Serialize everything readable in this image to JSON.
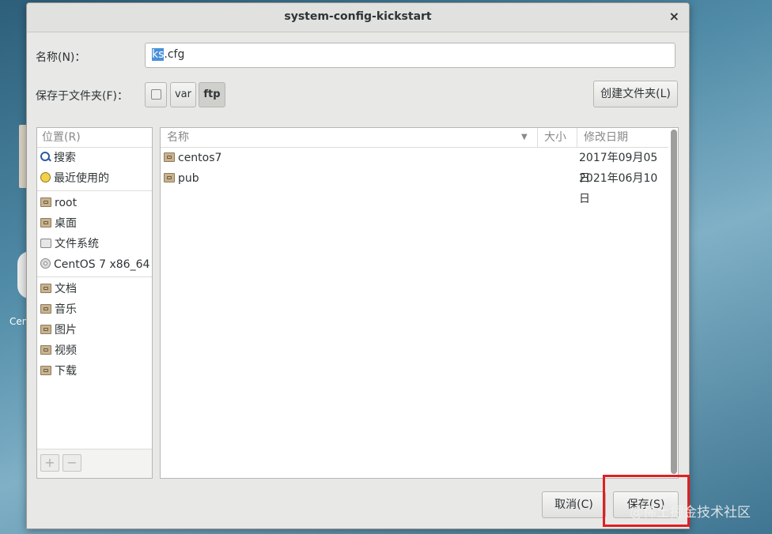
{
  "dialog": {
    "title": "system-config-kickstart",
    "close_glyph": "×",
    "name_label": "名称(N)：",
    "name_value_selected": "ks",
    "name_value_rest": ".cfg",
    "save_in_label": "保存于文件夹(F)：",
    "path_buttons": [
      "var",
      "ftp"
    ],
    "create_folder_label": "创建文件夹(L)",
    "cancel_label": "取消(C)",
    "save_label": "保存(S)"
  },
  "sidebar": {
    "header": "位置(R)",
    "items": [
      {
        "label": "搜索",
        "icon": "search-icon"
      },
      {
        "label": "最近使用的",
        "icon": "recent-icon"
      },
      {
        "label": "root",
        "icon": "home-folder-icon"
      },
      {
        "label": "桌面",
        "icon": "desktop-folder-icon"
      },
      {
        "label": "文件系统",
        "icon": "drive-icon"
      },
      {
        "label": "CentOS 7 x86_64",
        "icon": "disc-icon"
      },
      {
        "label": "文档",
        "icon": "documents-folder-icon"
      },
      {
        "label": "音乐",
        "icon": "music-folder-icon"
      },
      {
        "label": "图片",
        "icon": "pictures-folder-icon"
      },
      {
        "label": "视频",
        "icon": "videos-folder-icon"
      },
      {
        "label": "下载",
        "icon": "downloads-folder-icon"
      }
    ],
    "add_glyph": "+",
    "remove_glyph": "−"
  },
  "filelist": {
    "columns": [
      "名称",
      "大小",
      "修改日期"
    ],
    "rows": [
      {
        "name": "centos7",
        "size": "",
        "modified": "2017年09月05日"
      },
      {
        "name": "pub",
        "size": "",
        "modified": "2021年06月10日"
      }
    ]
  },
  "desktop": {
    "label": "Cen"
  },
  "watermark": "@稀土掘金技术社区",
  "colors": {
    "selection": "#4a90d9",
    "highlight_box": "#e02020"
  }
}
